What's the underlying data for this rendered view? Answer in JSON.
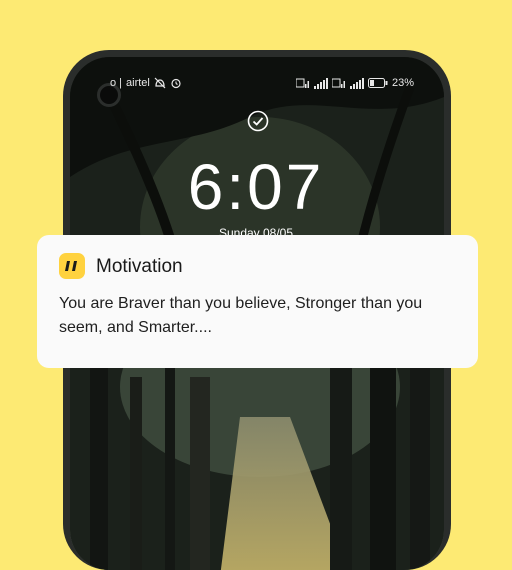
{
  "status_bar": {
    "carrier": "airtel",
    "battery": "23"
  },
  "lock_screen": {
    "time": "6:07",
    "date": "Sunday 08/05"
  },
  "notification": {
    "app_name": "Motivation",
    "app_icon": "quote-icon",
    "message": "You are Braver than you believe, Stronger than you seem, and Smarter....",
    "accent_color": "#ffd23f"
  },
  "background_color": "#fdea73"
}
